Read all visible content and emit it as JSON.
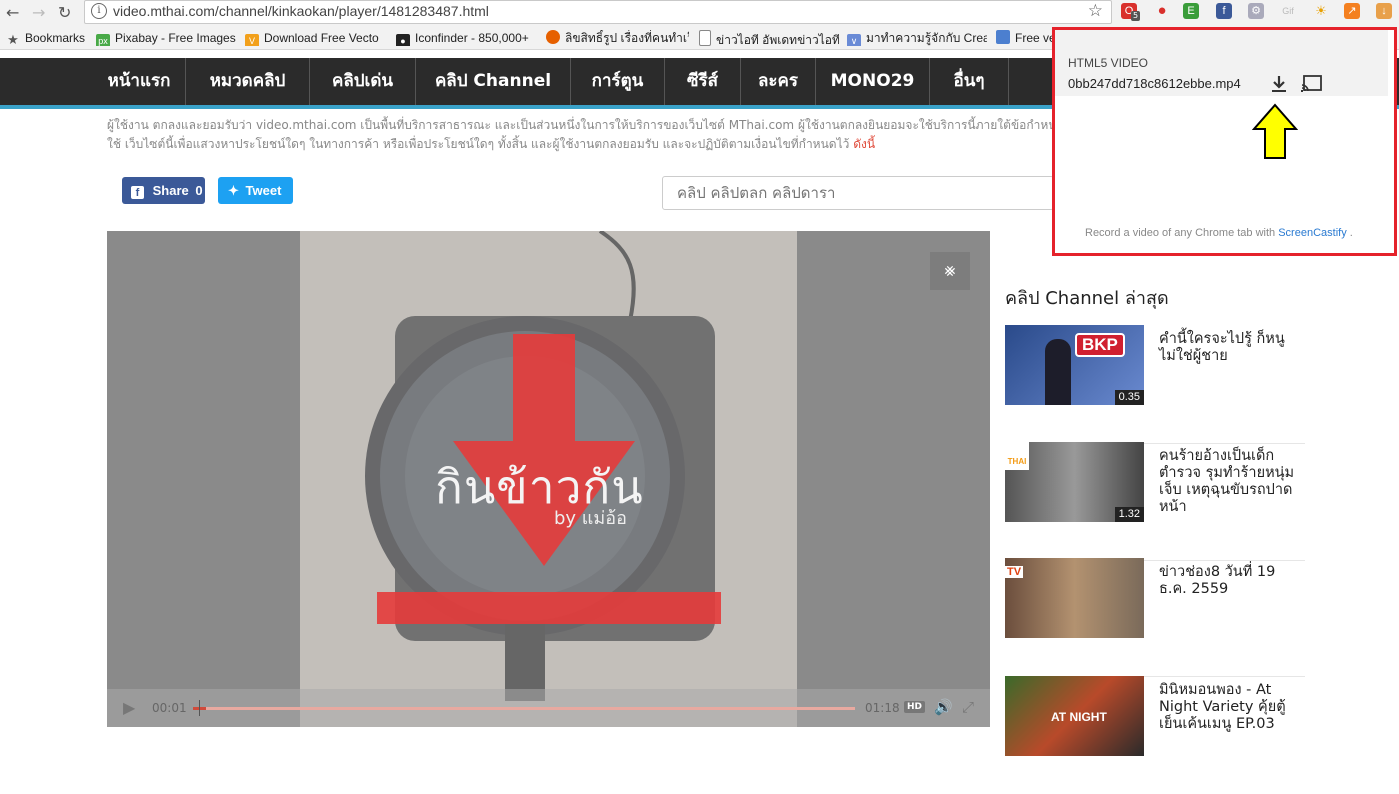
{
  "browser": {
    "url": "video.mthai.com/channel/kinkaokan/player/1481283487.html",
    "extension_badge": "5"
  },
  "bookmarks": [
    {
      "label": "Bookmarks",
      "icon": "star-icon"
    },
    {
      "label": "Pixabay - Free Images",
      "icon": "pixabay-icon",
      "color": "#48a947"
    },
    {
      "label": "Download Free Vecto",
      "icon": "vecteezy-icon",
      "color": "#f2a01b"
    },
    {
      "label": "Iconfinder - 850,000+",
      "icon": "iconfinder-icon",
      "color": "#222222"
    },
    {
      "label": "ลิขสิทธิ์รูป เรื่องที่คนทำเว็บ",
      "icon": "firefox-icon",
      "color": "#e66000"
    },
    {
      "label": "ข่าวไอที อัพเดทข่าวไอที ข่",
      "icon": "page-icon",
      "color": "#ffffff"
    },
    {
      "label": "มาทำความรู้จักกับ Creati",
      "icon": "creative-icon",
      "color": "#6a8bd6"
    },
    {
      "label": "Free ve",
      "icon": "freevector-icon",
      "color": "#4c7fcf"
    }
  ],
  "nav": [
    "หน้าแรก",
    "หมวดคลิป",
    "คลิปเด่น",
    "คลิป Channel",
    "การ์ตูน",
    "ซีรีส์",
    "ละคร",
    "MONO29",
    "อื่นๆ"
  ],
  "disclaimer": {
    "line1": "ผู้ใช้งาน ตกลงและยอมรับว่า video.mthai.com เป็นพื้นที่บริการสาธารณะ และเป็นส่วนหนึ่งในการให้บริการของเว็บไซต์ MThai.com ผู้ใช้งานตกลงยินยอมจะใช้บริการนี้ภายใต้ข้อกำหนดและ",
    "line2": "ใช้ เว็บไซต์นี้เพื่อแสวงหาประโยชน์ใดๆ ในทางการค้า หรือเพื่อประโยชน์ใดๆ ทั้งสิ้น และผู้ใช้งานตกลงยอมรับ และจะปฏิบัติตามเงื่อนไขที่กำหนดไว้ ",
    "link": "ดังนี้"
  },
  "social": {
    "share_label": "Share",
    "share_count": "0",
    "tweet_label": "Tweet"
  },
  "search": {
    "placeholder": "คลิป คลิปตลก คลิปดารา"
  },
  "player": {
    "title_overlay": "กินข้าวกัน",
    "by_overlay": "by แม่อ้อ",
    "current_time": "00:01",
    "duration": "01:18",
    "hd_label": "HD",
    "progress": 0.02
  },
  "sidebar": {
    "heading": "คลิป Channel ล่าสุด",
    "items": [
      {
        "title": "คำนี้ใครจะไปรู้ ก็หนูไม่ใช่ผู้ชาย",
        "duration": "0.35",
        "thumb_label": "BKP"
      },
      {
        "title": "คนร้ายอ้างเป็นเด็กตำรวจ รุมทำร้ายหนุ่มเจ็บ เหตุฉุนขับรถปาดหน้า",
        "duration": "1.32",
        "thumb_label": "THAI"
      },
      {
        "title": "ข่าวช่อง8 วันที่ 19 ธ.ค. 2559",
        "duration": "",
        "thumb_label": "TV"
      },
      {
        "title": "มินิหมอนพอง - At Night Variety คุ้ยตู้เย็นเค้นเมนู EP.03",
        "duration": "",
        "thumb_label": "AT NIGHT"
      }
    ]
  },
  "popup": {
    "heading": "HTML5 VIDEO",
    "filename": "0bb247dd718c8612ebbe.mp4",
    "footer_text": "Record a video of any Chrome tab with ",
    "footer_link": "ScreenCastify",
    "footer_end": " .",
    "accent": "#e5222b",
    "arrow_color": "#ffff00"
  }
}
